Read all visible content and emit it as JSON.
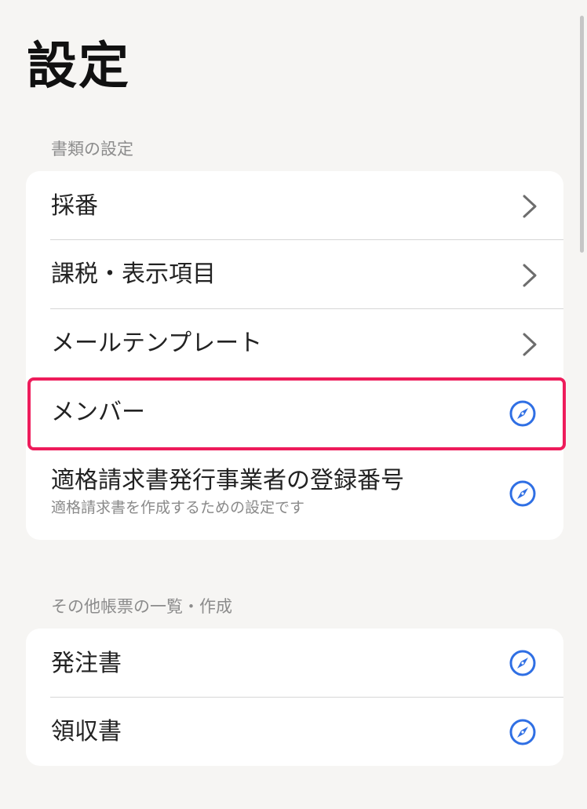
{
  "page": {
    "title": "設定"
  },
  "sections": [
    {
      "label": "書類の設定",
      "items": [
        {
          "label": "採番",
          "icon": "chevron-right-icon"
        },
        {
          "label": "課税・表示項目",
          "icon": "chevron-right-icon"
        },
        {
          "label": "メールテンプレート",
          "icon": "chevron-right-icon"
        },
        {
          "label": "メンバー",
          "icon": "compass-icon",
          "highlighted": true
        },
        {
          "label": "適格請求書発行事業者の登録番号",
          "sublabel": "適格請求書を作成するための設定です",
          "icon": "compass-icon"
        }
      ]
    },
    {
      "label": "その他帳票の一覧・作成",
      "items": [
        {
          "label": "発注書",
          "icon": "compass-icon"
        },
        {
          "label": "領収書",
          "icon": "compass-icon"
        }
      ]
    }
  ],
  "colors": {
    "background": "#f6f5f3",
    "card": "#ffffff",
    "accent": "#2f6fe4",
    "highlight": "#ee1c5b",
    "chevron": "#6d6d6d"
  }
}
